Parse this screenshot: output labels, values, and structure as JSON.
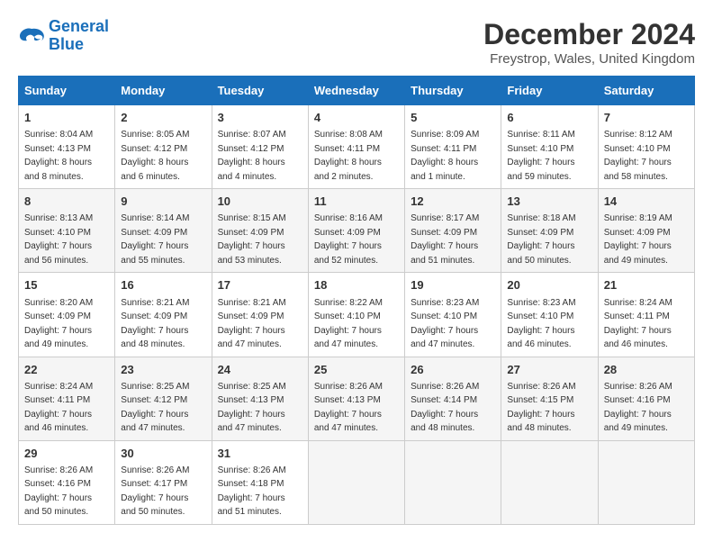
{
  "logo": {
    "line1": "General",
    "line2": "Blue"
  },
  "title": "December 2024",
  "subtitle": "Freystrop, Wales, United Kingdom",
  "days_of_week": [
    "Sunday",
    "Monday",
    "Tuesday",
    "Wednesday",
    "Thursday",
    "Friday",
    "Saturday"
  ],
  "weeks": [
    [
      {
        "day": "1",
        "sunrise": "8:04 AM",
        "sunset": "4:13 PM",
        "daylight": "8 hours and 8 minutes."
      },
      {
        "day": "2",
        "sunrise": "8:05 AM",
        "sunset": "4:12 PM",
        "daylight": "8 hours and 6 minutes."
      },
      {
        "day": "3",
        "sunrise": "8:07 AM",
        "sunset": "4:12 PM",
        "daylight": "8 hours and 4 minutes."
      },
      {
        "day": "4",
        "sunrise": "8:08 AM",
        "sunset": "4:11 PM",
        "daylight": "8 hours and 2 minutes."
      },
      {
        "day": "5",
        "sunrise": "8:09 AM",
        "sunset": "4:11 PM",
        "daylight": "8 hours and 1 minute."
      },
      {
        "day": "6",
        "sunrise": "8:11 AM",
        "sunset": "4:10 PM",
        "daylight": "7 hours and 59 minutes."
      },
      {
        "day": "7",
        "sunrise": "8:12 AM",
        "sunset": "4:10 PM",
        "daylight": "7 hours and 58 minutes."
      }
    ],
    [
      {
        "day": "8",
        "sunrise": "8:13 AM",
        "sunset": "4:10 PM",
        "daylight": "7 hours and 56 minutes."
      },
      {
        "day": "9",
        "sunrise": "8:14 AM",
        "sunset": "4:09 PM",
        "daylight": "7 hours and 55 minutes."
      },
      {
        "day": "10",
        "sunrise": "8:15 AM",
        "sunset": "4:09 PM",
        "daylight": "7 hours and 53 minutes."
      },
      {
        "day": "11",
        "sunrise": "8:16 AM",
        "sunset": "4:09 PM",
        "daylight": "7 hours and 52 minutes."
      },
      {
        "day": "12",
        "sunrise": "8:17 AM",
        "sunset": "4:09 PM",
        "daylight": "7 hours and 51 minutes."
      },
      {
        "day": "13",
        "sunrise": "8:18 AM",
        "sunset": "4:09 PM",
        "daylight": "7 hours and 50 minutes."
      },
      {
        "day": "14",
        "sunrise": "8:19 AM",
        "sunset": "4:09 PM",
        "daylight": "7 hours and 49 minutes."
      }
    ],
    [
      {
        "day": "15",
        "sunrise": "8:20 AM",
        "sunset": "4:09 PM",
        "daylight": "7 hours and 49 minutes."
      },
      {
        "day": "16",
        "sunrise": "8:21 AM",
        "sunset": "4:09 PM",
        "daylight": "7 hours and 48 minutes."
      },
      {
        "day": "17",
        "sunrise": "8:21 AM",
        "sunset": "4:09 PM",
        "daylight": "7 hours and 47 minutes."
      },
      {
        "day": "18",
        "sunrise": "8:22 AM",
        "sunset": "4:10 PM",
        "daylight": "7 hours and 47 minutes."
      },
      {
        "day": "19",
        "sunrise": "8:23 AM",
        "sunset": "4:10 PM",
        "daylight": "7 hours and 47 minutes."
      },
      {
        "day": "20",
        "sunrise": "8:23 AM",
        "sunset": "4:10 PM",
        "daylight": "7 hours and 46 minutes."
      },
      {
        "day": "21",
        "sunrise": "8:24 AM",
        "sunset": "4:11 PM",
        "daylight": "7 hours and 46 minutes."
      }
    ],
    [
      {
        "day": "22",
        "sunrise": "8:24 AM",
        "sunset": "4:11 PM",
        "daylight": "7 hours and 46 minutes."
      },
      {
        "day": "23",
        "sunrise": "8:25 AM",
        "sunset": "4:12 PM",
        "daylight": "7 hours and 47 minutes."
      },
      {
        "day": "24",
        "sunrise": "8:25 AM",
        "sunset": "4:13 PM",
        "daylight": "7 hours and 47 minutes."
      },
      {
        "day": "25",
        "sunrise": "8:26 AM",
        "sunset": "4:13 PM",
        "daylight": "7 hours and 47 minutes."
      },
      {
        "day": "26",
        "sunrise": "8:26 AM",
        "sunset": "4:14 PM",
        "daylight": "7 hours and 48 minutes."
      },
      {
        "day": "27",
        "sunrise": "8:26 AM",
        "sunset": "4:15 PM",
        "daylight": "7 hours and 48 minutes."
      },
      {
        "day": "28",
        "sunrise": "8:26 AM",
        "sunset": "4:16 PM",
        "daylight": "7 hours and 49 minutes."
      }
    ],
    [
      {
        "day": "29",
        "sunrise": "8:26 AM",
        "sunset": "4:16 PM",
        "daylight": "7 hours and 50 minutes."
      },
      {
        "day": "30",
        "sunrise": "8:26 AM",
        "sunset": "4:17 PM",
        "daylight": "7 hours and 50 minutes."
      },
      {
        "day": "31",
        "sunrise": "8:26 AM",
        "sunset": "4:18 PM",
        "daylight": "7 hours and 51 minutes."
      },
      null,
      null,
      null,
      null
    ]
  ],
  "labels": {
    "sunrise": "Sunrise: ",
    "sunset": "Sunset: ",
    "daylight": "Daylight: "
  }
}
